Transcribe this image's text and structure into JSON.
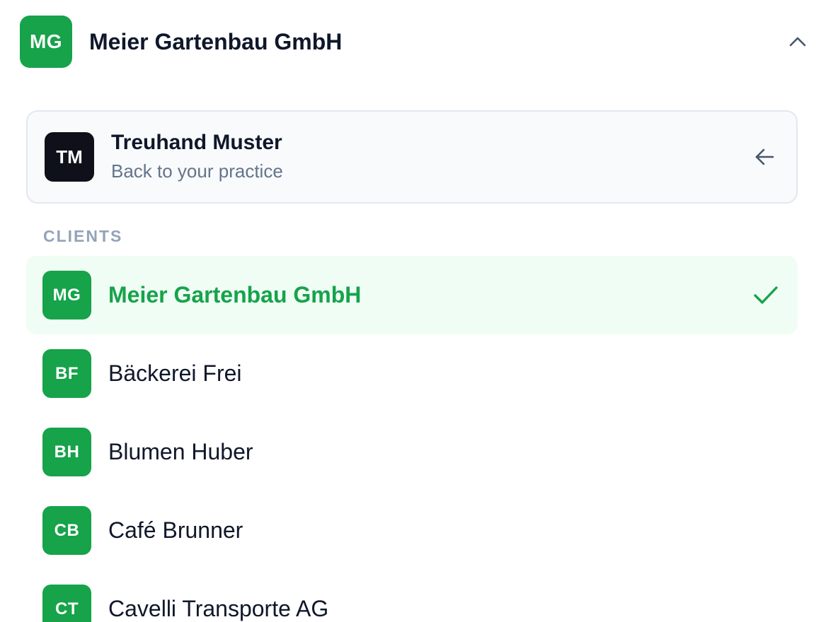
{
  "header": {
    "avatar_initials": "MG",
    "title": "Meier Gartenbau GmbH",
    "chevron_icon": "chevron-up-icon"
  },
  "practice": {
    "avatar_initials": "TM",
    "name": "Treuhand Muster",
    "subtitle": "Back to your practice",
    "arrow_icon": "arrow-left-icon"
  },
  "clients_label": "CLIENTS",
  "clients": [
    {
      "initials": "MG",
      "name": "Meier Gartenbau GmbH",
      "selected": true
    },
    {
      "initials": "BF",
      "name": "Bäckerei Frei",
      "selected": false
    },
    {
      "initials": "BH",
      "name": "Blumen Huber",
      "selected": false
    },
    {
      "initials": "CB",
      "name": "Café Brunner",
      "selected": false
    },
    {
      "initials": "CT",
      "name": "Cavelli Transporte AG",
      "selected": false
    }
  ],
  "colors": {
    "accent_green": "#16a34a",
    "selected_bg": "#f0fdf4",
    "practice_avatar": "#0f111a",
    "muted_text": "#64748b",
    "section_label": "#94a3b8"
  }
}
